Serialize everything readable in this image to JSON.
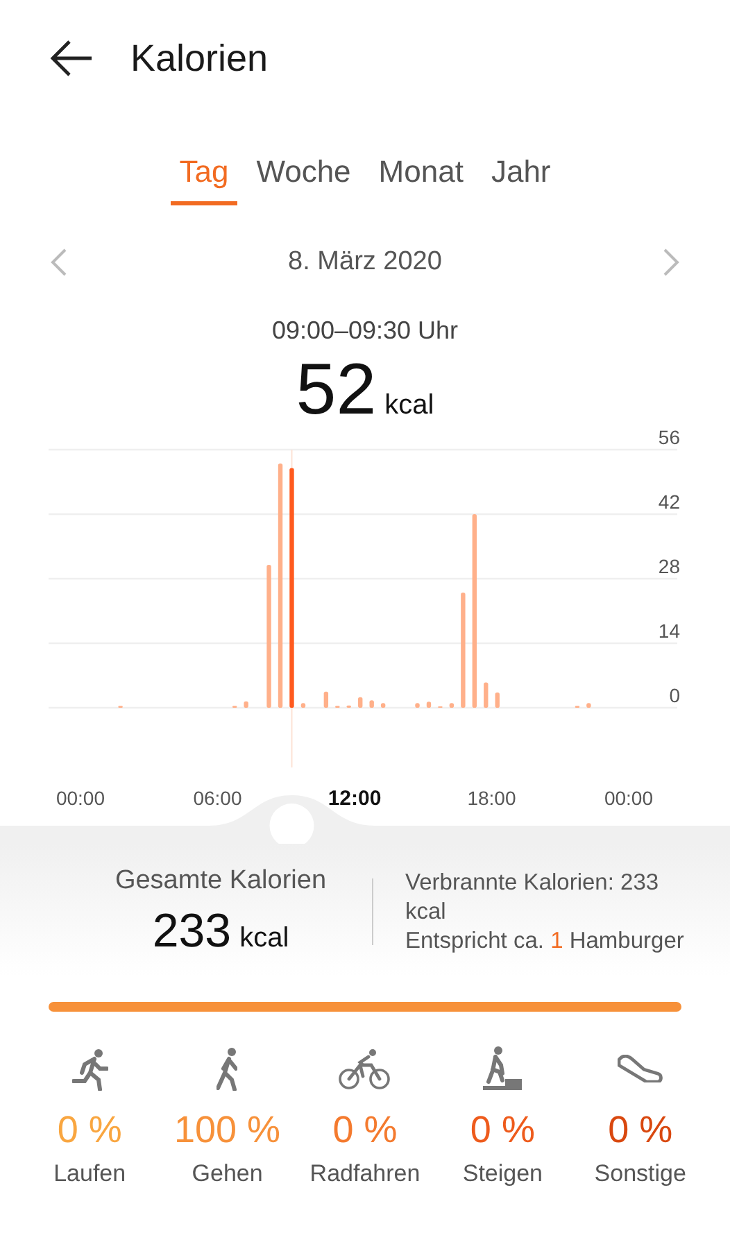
{
  "header": {
    "title": "Kalorien"
  },
  "tabs": [
    {
      "label": "Tag",
      "selected": true
    },
    {
      "label": "Woche",
      "selected": false
    },
    {
      "label": "Monat",
      "selected": false
    },
    {
      "label": "Jahr",
      "selected": false
    }
  ],
  "date_nav": {
    "date": "8. März 2020",
    "prev_disabled": true,
    "next_disabled": true
  },
  "selection": {
    "range": "09:00–09:30 Uhr",
    "value": "52",
    "unit": "kcal"
  },
  "chart": {
    "chart_data": {
      "type": "bar",
      "grid": true,
      "x": [
        1.75,
        6.75,
        7.25,
        8.25,
        8.75,
        9.25,
        9.75,
        10.75,
        11.25,
        11.75,
        12.25,
        12.75,
        13.25,
        14.75,
        15.25,
        15.75,
        16.25,
        16.75,
        17.25,
        17.75,
        18.25,
        21.75,
        22.25
      ],
      "values": [
        0.4,
        0.4,
        1.4,
        31,
        53,
        52,
        1,
        3.5,
        0.4,
        0.5,
        2.3,
        1.6,
        1,
        1,
        1.3,
        0.3,
        1,
        25,
        42,
        5.5,
        3.3,
        0.4,
        1
      ],
      "ref_lines": [
        {
          "axis": "x",
          "value": 9.25
        }
      ],
      "xlim": [
        0,
        24
      ],
      "ylim": [
        0,
        56
      ],
      "yticks": [
        0,
        14,
        28,
        42,
        56
      ],
      "xticks": [
        {
          "value": 0,
          "label": "00:00"
        },
        {
          "value": 6,
          "label": "06:00"
        },
        {
          "value": 12,
          "label": "12:00"
        },
        {
          "value": 18,
          "label": "18:00"
        },
        {
          "value": 24,
          "label": "00:00"
        }
      ]
    }
  },
  "summary": {
    "total_label": "Gesamte Kalorien",
    "total_value": "233",
    "total_unit": "kcal",
    "burned": "Verbrannte Kalorien: 233 kcal",
    "equivalent_prefix": "Entspricht ca.",
    "equivalent_count": "1",
    "equivalent_item": "Hamburger"
  },
  "activities": [
    {
      "kind": "run",
      "percent": "0 %",
      "label": "Laufen",
      "color": "#f9a640"
    },
    {
      "kind": "walk",
      "percent": "100 %",
      "label": "Gehen",
      "level": 1,
      "color": "#f7913a"
    },
    {
      "kind": "cycle",
      "percent": "0 %",
      "label": "Radfahren",
      "color": "#f47a2e"
    },
    {
      "kind": "climb",
      "percent": "0 %",
      "label": "Steigen",
      "color": "#ee5b1c"
    },
    {
      "kind": "other",
      "percent": "0 %",
      "label": "Sonstige",
      "color": "#d9480f"
    }
  ]
}
